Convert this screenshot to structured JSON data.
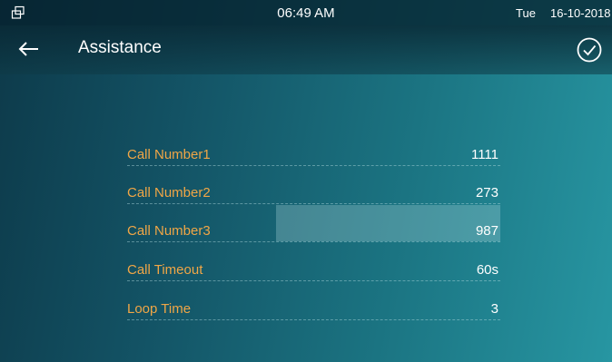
{
  "status_bar": {
    "time": "06:49 AM",
    "day": "Tue",
    "date": "16-10-2018",
    "left_icon": "window-restore-icon"
  },
  "header": {
    "title": "Assistance",
    "back_icon": "back-arrow-icon",
    "confirm_icon": "check-circle-icon"
  },
  "settings": [
    {
      "label": "Call Number1",
      "value": "1111",
      "selected": false
    },
    {
      "label": "Call Number2",
      "value": "273",
      "selected": false
    },
    {
      "label": "Call Number3",
      "value": "987",
      "selected": true
    },
    {
      "label": "Call Timeout",
      "value": "60s",
      "selected": false
    },
    {
      "label": "Loop Time",
      "value": "3",
      "selected": false
    }
  ],
  "colors": {
    "label": "#f0a646",
    "value": "#ffffff",
    "background_dark": "#0d3a4a",
    "background_light": "#2796a2"
  }
}
